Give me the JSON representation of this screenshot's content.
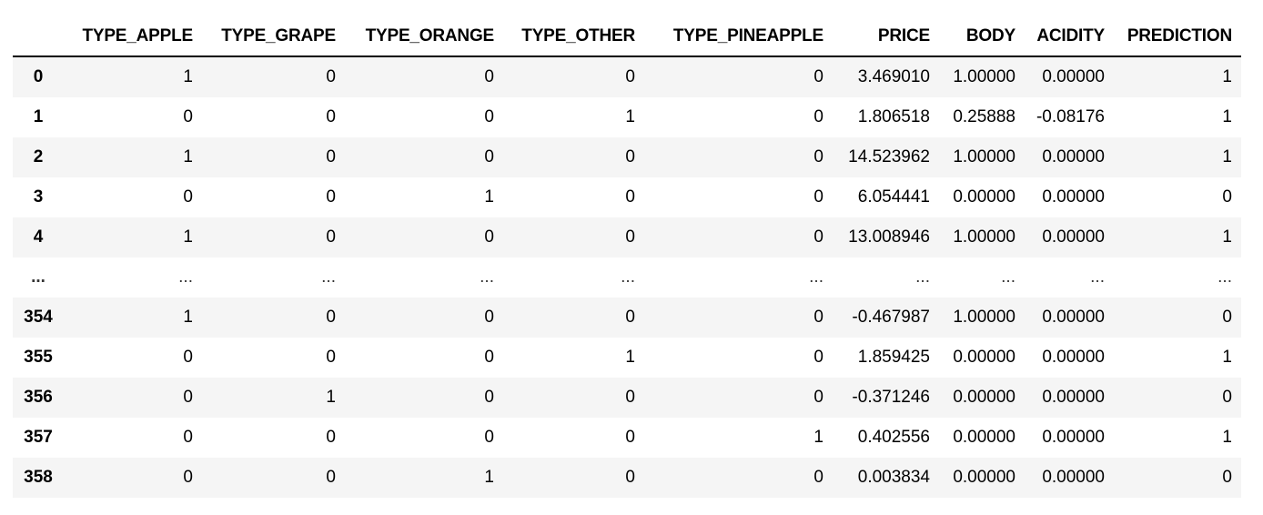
{
  "table": {
    "index_header": "",
    "columns": [
      "TYPE_APPLE",
      "TYPE_GRAPE",
      "TYPE_ORANGE",
      "TYPE_OTHER",
      "TYPE_PINEAPPLE",
      "PRICE",
      "BODY",
      "ACIDITY",
      "PREDICTION"
    ],
    "rows": [
      {
        "index": "0",
        "cells": [
          "1",
          "0",
          "0",
          "0",
          "0",
          "3.469010",
          "1.00000",
          "0.00000",
          "1"
        ]
      },
      {
        "index": "1",
        "cells": [
          "0",
          "0",
          "0",
          "1",
          "0",
          "1.806518",
          "0.25888",
          "-0.08176",
          "1"
        ]
      },
      {
        "index": "2",
        "cells": [
          "1",
          "0",
          "0",
          "0",
          "0",
          "14.523962",
          "1.00000",
          "0.00000",
          "1"
        ]
      },
      {
        "index": "3",
        "cells": [
          "0",
          "0",
          "1",
          "0",
          "0",
          "6.054441",
          "0.00000",
          "0.00000",
          "0"
        ]
      },
      {
        "index": "4",
        "cells": [
          "1",
          "0",
          "0",
          "0",
          "0",
          "13.008946",
          "1.00000",
          "0.00000",
          "1"
        ]
      },
      {
        "index": "...",
        "cells": [
          "...",
          "...",
          "...",
          "...",
          "...",
          "...",
          "...",
          "...",
          "..."
        ]
      },
      {
        "index": "354",
        "cells": [
          "1",
          "0",
          "0",
          "0",
          "0",
          "-0.467987",
          "1.00000",
          "0.00000",
          "0"
        ]
      },
      {
        "index": "355",
        "cells": [
          "0",
          "0",
          "0",
          "1",
          "0",
          "1.859425",
          "0.00000",
          "0.00000",
          "1"
        ]
      },
      {
        "index": "356",
        "cells": [
          "0",
          "1",
          "0",
          "0",
          "0",
          "-0.371246",
          "0.00000",
          "0.00000",
          "0"
        ]
      },
      {
        "index": "357",
        "cells": [
          "0",
          "0",
          "0",
          "0",
          "1",
          "0.402556",
          "0.00000",
          "0.00000",
          "1"
        ]
      },
      {
        "index": "358",
        "cells": [
          "0",
          "0",
          "1",
          "0",
          "0",
          "0.003834",
          "0.00000",
          "0.00000",
          "0"
        ]
      }
    ]
  }
}
